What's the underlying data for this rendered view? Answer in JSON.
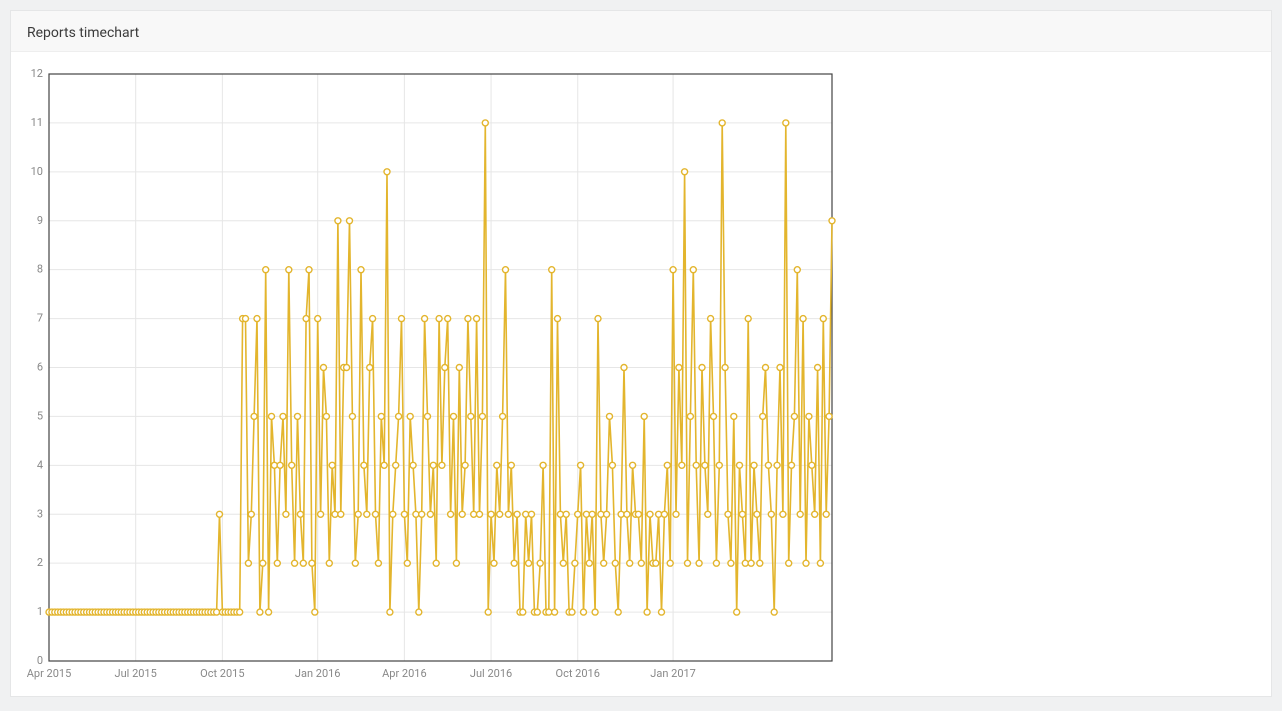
{
  "panel": {
    "title": "Reports timechart"
  },
  "chart_data": {
    "type": "line",
    "title": "Reports timechart",
    "xlabel": "",
    "ylabel": "",
    "ylim": [
      0,
      12
    ],
    "y_ticks": [
      0,
      1,
      2,
      3,
      4,
      5,
      6,
      7,
      8,
      9,
      10,
      11,
      12
    ],
    "x_tick_labels": [
      "Apr 2015",
      "Jul 2015",
      "Oct 2015",
      "Jan 2016",
      "Apr 2016",
      "Jul 2016",
      "Oct 2016",
      "Jan 2017"
    ],
    "color": "#e3b52d",
    "marker": "circle",
    "x": [
      0,
      1,
      2,
      3,
      4,
      5,
      6,
      7,
      8,
      9,
      10,
      11,
      12,
      13,
      14,
      15,
      16,
      17,
      18,
      19,
      20,
      21,
      22,
      23,
      24,
      25,
      26,
      27,
      28,
      29,
      30,
      31,
      32,
      33,
      34,
      35,
      36,
      37,
      38,
      39,
      40,
      41,
      42,
      43,
      44,
      45,
      46,
      47,
      48,
      49,
      50,
      51,
      52,
      53,
      54,
      55,
      56,
      57,
      58,
      59,
      60,
      61,
      62,
      63,
      64,
      65,
      66,
      67,
      68,
      69,
      70,
      71,
      72,
      73,
      74,
      75,
      76,
      77,
      78,
      79,
      80,
      81,
      82,
      83,
      84,
      85,
      86,
      87,
      88,
      89,
      90,
      91,
      92,
      93,
      94,
      95,
      96,
      97,
      98,
      99,
      100,
      101,
      102,
      103,
      104,
      105,
      106,
      107,
      108,
      109,
      110,
      111,
      112,
      113,
      114,
      115,
      116,
      117,
      118,
      119,
      120,
      121,
      122,
      123,
      124,
      125,
      126,
      127,
      128,
      129,
      130,
      131,
      132,
      133,
      134,
      135,
      136,
      137,
      138,
      139,
      140,
      141,
      142,
      143,
      144,
      145,
      146,
      147,
      148,
      149,
      150,
      151,
      152,
      153,
      154,
      155,
      156,
      157,
      158,
      159,
      160,
      161,
      162,
      163,
      164,
      165,
      166,
      167,
      168,
      169,
      170,
      171,
      172,
      173,
      174,
      175,
      176,
      177,
      178,
      179,
      180,
      181,
      182,
      183,
      184,
      185,
      186,
      187,
      188,
      189,
      190,
      191,
      192,
      193,
      194,
      195,
      196,
      197,
      198,
      199,
      200,
      201,
      202,
      203,
      204,
      205,
      206,
      207,
      208,
      209,
      210,
      211,
      212,
      213,
      214,
      215,
      216,
      217,
      218,
      219,
      220,
      221,
      222,
      223,
      224,
      225,
      226,
      227,
      228,
      229,
      230,
      231,
      232,
      233,
      234,
      235,
      236,
      237,
      238,
      239,
      240,
      241,
      242,
      243,
      244,
      245,
      246,
      247,
      248,
      249,
      250,
      251,
      252,
      253,
      254,
      255,
      256,
      257,
      258,
      259,
      260,
      261,
      262,
      263,
      264,
      265,
      266,
      267,
      268,
      269,
      270,
      271
    ],
    "values": [
      1,
      1,
      1,
      1,
      1,
      1,
      1,
      1,
      1,
      1,
      1,
      1,
      1,
      1,
      1,
      1,
      1,
      1,
      1,
      1,
      1,
      1,
      1,
      1,
      1,
      1,
      1,
      1,
      1,
      1,
      1,
      1,
      1,
      1,
      1,
      1,
      1,
      1,
      1,
      1,
      1,
      1,
      1,
      1,
      1,
      1,
      1,
      1,
      1,
      1,
      1,
      1,
      1,
      1,
      1,
      1,
      1,
      1,
      1,
      3,
      1,
      1,
      1,
      1,
      1,
      1,
      1,
      7,
      7,
      2,
      3,
      5,
      7,
      1,
      2,
      8,
      1,
      5,
      4,
      2,
      4,
      5,
      3,
      8,
      4,
      2,
      5,
      3,
      2,
      7,
      8,
      2,
      1,
      7,
      3,
      6,
      5,
      2,
      4,
      3,
      9,
      3,
      6,
      6,
      9,
      5,
      2,
      3,
      8,
      4,
      3,
      6,
      7,
      3,
      2,
      5,
      4,
      10,
      1,
      3,
      4,
      5,
      7,
      3,
      2,
      5,
      4,
      3,
      1,
      3,
      7,
      5,
      3,
      4,
      2,
      7,
      4,
      6,
      7,
      3,
      5,
      2,
      6,
      3,
      4,
      7,
      5,
      3,
      7,
      3,
      5,
      11,
      1,
      3,
      2,
      4,
      3,
      5,
      8,
      3,
      4,
      2,
      3,
      1,
      1,
      3,
      2,
      3,
      1,
      1,
      2,
      4,
      1,
      1,
      8,
      1,
      7,
      3,
      2,
      3,
      1,
      1,
      2,
      3,
      4,
      1,
      3,
      2,
      3,
      1,
      7,
      3,
      2,
      3,
      5,
      4,
      2,
      1,
      3,
      6,
      3,
      2,
      4,
      3,
      3,
      2,
      5,
      1,
      3,
      2,
      2,
      3,
      1,
      3,
      4,
      2,
      8,
      3,
      6,
      4,
      10,
      2,
      5,
      8,
      4,
      2,
      6,
      4,
      3,
      7,
      5,
      2,
      4,
      11,
      6,
      3,
      2,
      5,
      1,
      4,
      3,
      2,
      7,
      2,
      4,
      3,
      2,
      5,
      6,
      4,
      3,
      1,
      4,
      6,
      3,
      11,
      2,
      4,
      5,
      8,
      3,
      7,
      2,
      5,
      4,
      3,
      6,
      2,
      7,
      3,
      5,
      9
    ],
    "x_tick_positions": [
      0,
      30,
      60,
      93,
      123,
      153,
      183,
      216
    ],
    "x_range": [
      0,
      271
    ]
  }
}
